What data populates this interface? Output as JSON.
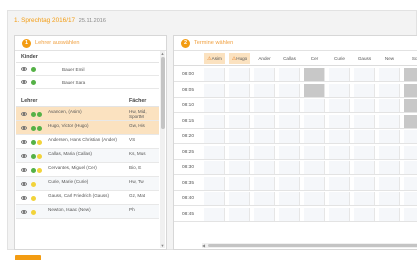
{
  "header": {
    "title": "1. Sprechtag 2016/17",
    "date": "25.11.2016"
  },
  "left_panel": {
    "step": "1",
    "title": "Lehrer auswählen",
    "children_header": "Kinder",
    "children": [
      {
        "name": "Bauer Emil"
      },
      {
        "name": "Bauer Sara"
      }
    ],
    "teacher_header": "Lehrer",
    "subject_header": "Fächer",
    "teachers": [
      {
        "name": "Avancen, (Asim)",
        "subjects": "Hw, Mid, SportM",
        "selected": true,
        "dot1": "#55b146",
        "dot2": "#55b146"
      },
      {
        "name": "Hugo, Victor (Hugo)",
        "subjects": "Gw, His",
        "selected": true,
        "dot1": "#55b146",
        "dot2": "#55b146"
      },
      {
        "name": "Andersen, Hans Christian (Ander)",
        "subjects": "VS",
        "selected": false,
        "dot1": "#55b146",
        "dot2": "#f2d33a"
      },
      {
        "name": "Callas, Maria (Callas)",
        "subjects": "Ks, Mus",
        "selected": false,
        "dot1": "#55b146",
        "dot2": "#f2d33a"
      },
      {
        "name": "Cervantes, Miguel (Cer)",
        "subjects": "Bio, E",
        "selected": false,
        "dot1": "#55b146",
        "dot2": "#f2d33a"
      },
      {
        "name": "Curie, Marie (Curie)",
        "subjects": "Hw, Tw",
        "selected": false,
        "dot1": "#f2d33a",
        "dot2": ""
      },
      {
        "name": "Gauss, Carl Friedrich (Gauss)",
        "subjects": "Gz, Mat",
        "selected": false,
        "dot1": "#f2d33a",
        "dot2": ""
      },
      {
        "name": "Newton, Isaac (New)",
        "subjects": "Ph",
        "selected": false,
        "dot1": "#f2d33a",
        "dot2": ""
      }
    ]
  },
  "right_panel": {
    "step": "2",
    "title": "Termine wählen",
    "warning_icon": "warning-triangle-icon",
    "columns": [
      {
        "label": "Asim",
        "highlight": true,
        "warn": true
      },
      {
        "label": "Hugo",
        "highlight": true,
        "warn": true
      },
      {
        "label": "Ander",
        "highlight": false,
        "warn": false
      },
      {
        "label": "Callas",
        "highlight": false,
        "warn": false
      },
      {
        "label": "Cer",
        "highlight": false,
        "warn": false
      },
      {
        "label": "Curie",
        "highlight": false,
        "warn": false
      },
      {
        "label": "Gauss",
        "highlight": false,
        "warn": false
      },
      {
        "label": "New",
        "highlight": false,
        "warn": false
      },
      {
        "label": "Sc",
        "highlight": false,
        "warn": false
      }
    ],
    "times": [
      "08:00",
      "08:05",
      "08:10",
      "08:15",
      "08:20",
      "08:25",
      "08:30",
      "08:35",
      "08:40",
      "08:45"
    ],
    "busy": [
      {
        "time": 0,
        "cols": [
          4,
          8
        ]
      },
      {
        "time": 1,
        "cols": [
          4,
          8
        ]
      },
      {
        "time": 2,
        "cols": [
          8
        ]
      },
      {
        "time": 3,
        "cols": [
          8
        ]
      }
    ]
  },
  "colors": {
    "accent": "#f39c12",
    "selected_row": "#fbe2c0",
    "busy_cell": "#c8c8c8"
  }
}
